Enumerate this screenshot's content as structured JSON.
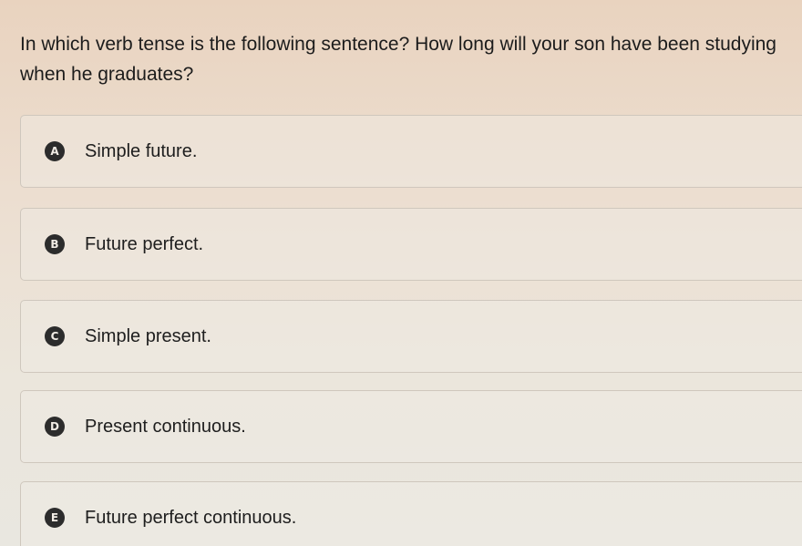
{
  "question": {
    "text": "In which verb tense is the following sentence? How long will your son have been studying when he graduates?"
  },
  "options": [
    {
      "letter": "A",
      "label": "Simple future."
    },
    {
      "letter": "B",
      "label": "Future perfect."
    },
    {
      "letter": "C",
      "label": "Simple present."
    },
    {
      "letter": "D",
      "label": "Present continuous."
    },
    {
      "letter": "E",
      "label": "Future perfect continuous."
    }
  ]
}
